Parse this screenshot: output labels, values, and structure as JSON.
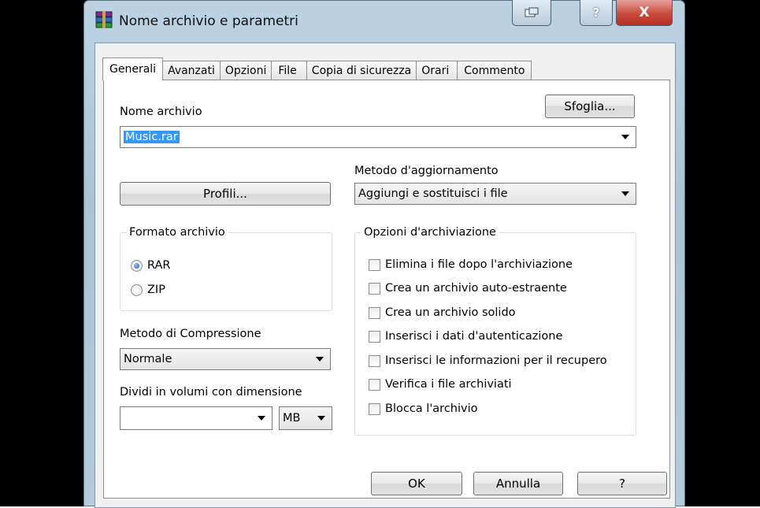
{
  "window": {
    "title": "Nome archivio e parametri",
    "close_glyph": "X",
    "help_glyph": "?"
  },
  "tabs": [
    "Generali",
    "Avanzati",
    "Opzioni",
    "File",
    "Copia di sicurezza",
    "Orari",
    "Commento"
  ],
  "active_tab": "Generali",
  "archive": {
    "label": "Nome archivio",
    "browse_label": "Sfoglia...",
    "value": "Music.rar"
  },
  "profiles_label": "Profili...",
  "update": {
    "label": "Metodo d'aggiornamento",
    "value": "Aggiungi e sostituisci i file"
  },
  "format": {
    "legend": "Formato archivio",
    "options": [
      "RAR",
      "ZIP"
    ],
    "selected": "RAR"
  },
  "compression": {
    "label": "Metodo di Compressione",
    "value": "Normale"
  },
  "split": {
    "label": "Dividi in volumi con dimensione",
    "size": "",
    "unit": "MB"
  },
  "archive_options": {
    "legend": "Opzioni d'archiviazione",
    "items": [
      "Elimina i file dopo l'archiviazione",
      "Crea un archivio auto-estraente",
      "Crea un archivio solido",
      "Inserisci i dati d'autenticazione",
      "Inserisci le informazioni per il recupero",
      "Verifica i file archiviati",
      "Blocca l'archivio"
    ]
  },
  "footer": {
    "ok": "OK",
    "cancel": "Annulla",
    "help": "?"
  },
  "colors": {
    "selection": "#3399ff",
    "close_button": "#c9493c"
  },
  "icons": {
    "app": "winrar-books-icon",
    "restore": "restore-icon"
  }
}
